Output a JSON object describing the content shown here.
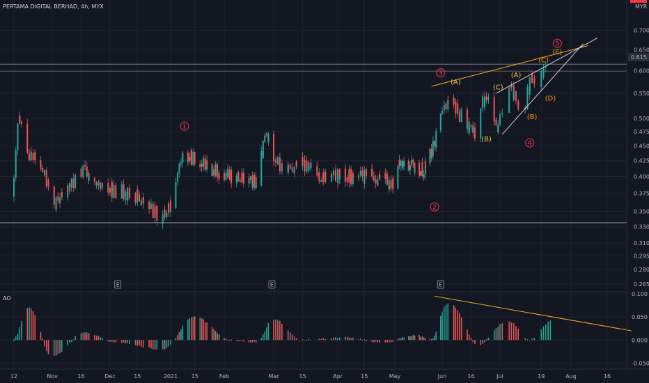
{
  "header": {
    "title": "PERTAMA DIGITAL BERHAD, 4h, MYX",
    "currency": "MYR",
    "last_price": "0.615",
    "indicator": "AO"
  },
  "colors": {
    "bg": "#131722",
    "up": "#26a69a",
    "down": "#ef5350",
    "ao_up": "#26a69a",
    "ao_down": "#ef5350",
    "trend": "#f5a623",
    "channel": "#d1d4dc",
    "grid": "#1e222d"
  },
  "chart_data": [
    {
      "type": "candlestick",
      "yscale": "log",
      "ylim": [
        0.26,
        0.72
      ],
      "y_ticks": [
        "0.700",
        "0.650",
        "0.600",
        "0.550",
        "0.500",
        "0.475",
        "0.450",
        "0.425",
        "0.400",
        "0.375",
        "0.350",
        "0.330",
        "0.310",
        "0.295",
        "0.280",
        "0.265"
      ],
      "x_ticks": [
        "12",
        "Nov",
        "16",
        "Dec",
        "15",
        "2021",
        "15",
        "Feb",
        "Mar",
        "15",
        "Apr",
        "15",
        "May",
        "Jun",
        "16",
        "Jul",
        "19",
        "Aug",
        "16"
      ],
      "horizontal_levels": [
        0.615,
        0.335
      ],
      "close_anchors": [
        [
          "2020-10-12",
          0.37
        ],
        [
          "2020-10-15",
          0.5
        ],
        [
          "2020-10-20",
          0.44
        ],
        [
          "2020-10-27",
          0.41
        ],
        [
          "2020-11-03",
          0.36
        ],
        [
          "2020-11-12",
          0.39
        ],
        [
          "2020-11-18",
          0.41
        ],
        [
          "2020-11-25",
          0.38
        ],
        [
          "2020-12-05",
          0.38
        ],
        [
          "2020-12-15",
          0.37
        ],
        [
          "2020-12-28",
          0.34
        ],
        [
          "2021-01-01",
          0.36
        ],
        [
          "2021-01-08",
          0.43
        ],
        [
          "2021-01-15",
          0.43
        ],
        [
          "2021-01-25",
          0.41
        ],
        [
          "2021-02-05",
          0.4
        ],
        [
          "2021-02-20",
          0.39
        ],
        [
          "2021-02-25",
          0.47
        ],
        [
          "2021-03-05",
          0.41
        ],
        [
          "2021-03-15",
          0.42
        ],
        [
          "2021-03-25",
          0.4
        ],
        [
          "2021-04-05",
          0.4
        ],
        [
          "2021-04-20",
          0.4
        ],
        [
          "2021-04-30",
          0.39
        ],
        [
          "2021-05-05",
          0.42
        ],
        [
          "2021-05-20",
          0.41
        ],
        [
          "2021-05-28",
          0.46
        ],
        [
          "2021-06-01",
          0.5
        ],
        [
          "2021-06-05",
          0.55
        ],
        [
          "2021-06-10",
          0.51
        ],
        [
          "2021-06-18",
          0.47
        ],
        [
          "2021-06-24",
          0.55
        ],
        [
          "2021-06-30",
          0.47
        ],
        [
          "2021-07-05",
          0.56
        ],
        [
          "2021-07-12",
          0.52
        ],
        [
          "2021-07-15",
          0.58
        ],
        [
          "2021-07-18",
          0.56
        ],
        [
          "2021-07-21",
          0.615
        ]
      ],
      "wave_labels": [
        {
          "label": "1",
          "date": "2021-01-09",
          "price": 0.485,
          "kind": "major"
        },
        {
          "label": "2",
          "date": "2021-05-27",
          "price": 0.356,
          "kind": "major"
        },
        {
          "label": "3",
          "date": "2021-05-31",
          "price": 0.595,
          "kind": "major"
        },
        {
          "label": "4",
          "date": "2021-07-14",
          "price": 0.455,
          "kind": "major"
        },
        {
          "label": "5",
          "date": "2021-07-26",
          "price": 0.666,
          "kind": "major"
        },
        {
          "label": "(A)",
          "date": "2021-06-08",
          "price": 0.575,
          "kind": "minor"
        },
        {
          "label": "(B)",
          "date": "2021-06-24",
          "price": 0.462,
          "kind": "minor"
        },
        {
          "label": "(C)",
          "date": "2021-06-30",
          "price": 0.563,
          "kind": "minor"
        },
        {
          "label": "(A)",
          "date": "2021-07-08",
          "price": 0.59,
          "kind": "minor"
        },
        {
          "label": "(B)",
          "date": "2021-07-15",
          "price": 0.503,
          "kind": "minor"
        },
        {
          "label": "(C)",
          "date": "2021-07-20",
          "price": 0.625,
          "kind": "minor"
        },
        {
          "label": "(D)",
          "date": "2021-07-23",
          "price": 0.54,
          "kind": "minor"
        },
        {
          "label": "(E)",
          "date": "2021-07-26",
          "price": 0.645,
          "kind": "minor"
        }
      ],
      "trend_lines": [
        {
          "name": "upper-resistance",
          "color": "#f5a623",
          "from": [
            "2021-05-25",
            0.565
          ],
          "to": [
            "2021-08-08",
            0.66
          ]
        },
        {
          "name": "channel-upper",
          "color": "#d1d4dc",
          "from": [
            "2021-06-29",
            0.55
          ],
          "to": [
            "2021-08-12",
            0.68
          ]
        },
        {
          "name": "channel-lower",
          "color": "#d1d4dc",
          "from": [
            "2021-07-02",
            0.47
          ],
          "to": [
            "2021-08-06",
            0.665
          ]
        }
      ],
      "event_markers": [
        {
          "label": "E",
          "date": "2020-12-05"
        },
        {
          "label": "E",
          "date": "2021-02-28"
        },
        {
          "label": "E",
          "date": "2021-05-31"
        }
      ]
    },
    {
      "type": "bar",
      "name": "AO",
      "ylim": [
        -0.06,
        0.1
      ],
      "y_ticks": [
        "0.100",
        "0.050",
        "0.000",
        "-0.050"
      ],
      "anchors": [
        [
          "2020-10-12",
          0.0
        ],
        [
          "2020-10-20",
          0.07
        ],
        [
          "2020-11-01",
          -0.035
        ],
        [
          "2020-11-18",
          0.015
        ],
        [
          "2020-12-05",
          -0.005
        ],
        [
          "2020-12-28",
          -0.02
        ],
        [
          "2021-01-15",
          0.05
        ],
        [
          "2021-02-05",
          0.0
        ],
        [
          "2021-02-20",
          -0.005
        ],
        [
          "2021-03-01",
          0.045
        ],
        [
          "2021-03-15",
          0.0
        ],
        [
          "2021-04-05",
          0.005
        ],
        [
          "2021-04-25",
          -0.005
        ],
        [
          "2021-05-15",
          0.01
        ],
        [
          "2021-05-25",
          0.0
        ],
        [
          "2021-06-05",
          0.08
        ],
        [
          "2021-06-20",
          -0.01
        ],
        [
          "2021-07-05",
          0.04
        ],
        [
          "2021-07-14",
          0.0
        ],
        [
          "2021-07-25",
          0.045
        ]
      ],
      "trend_line": {
        "color": "#f5a623",
        "from": [
          "2021-05-27",
          0.095
        ],
        "to": [
          "2021-08-26",
          0.02
        ]
      }
    }
  ]
}
